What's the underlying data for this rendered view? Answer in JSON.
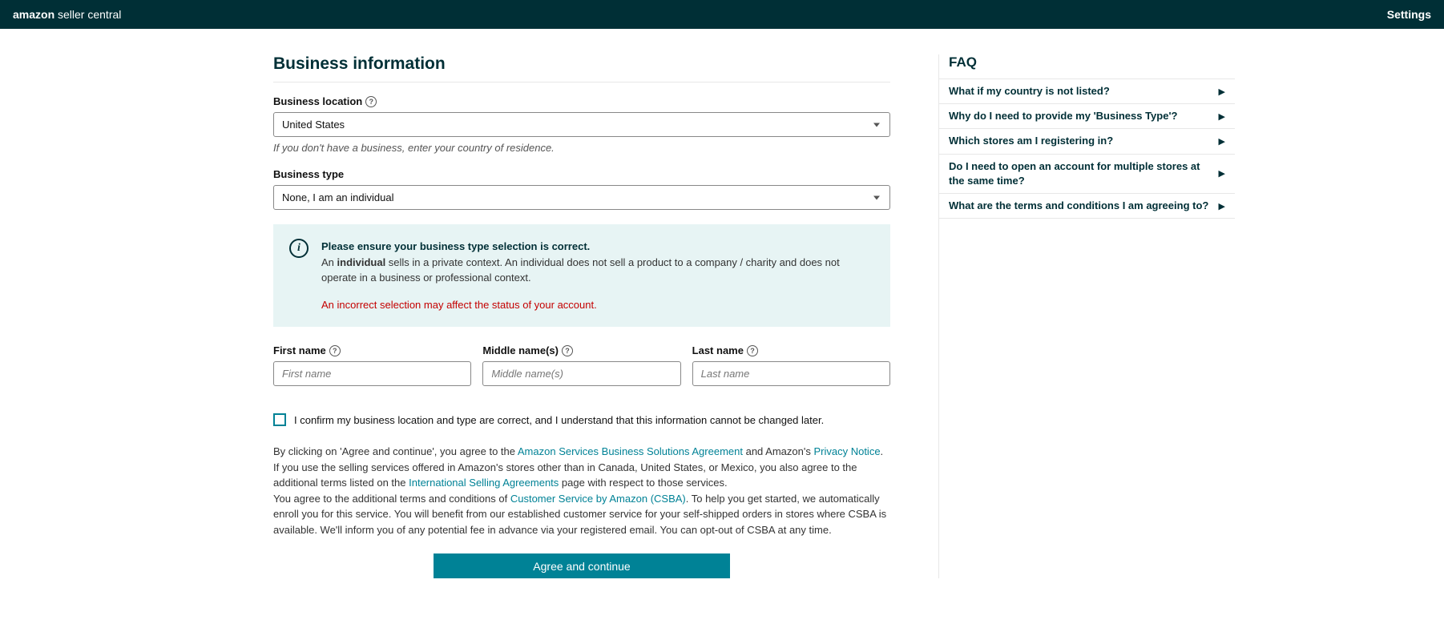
{
  "header": {
    "logo_prefix": "amazon",
    "logo_suffix": "seller central",
    "settings": "Settings"
  },
  "page": {
    "title": "Business information"
  },
  "form": {
    "business_location": {
      "label": "Business location",
      "value": "United States",
      "hint": "If you don't have a business, enter your country of residence."
    },
    "business_type": {
      "label": "Business type",
      "value": "None, I am an individual"
    },
    "first_name": {
      "label": "First name",
      "placeholder": "First name",
      "value": ""
    },
    "middle_name": {
      "label": "Middle name(s)",
      "placeholder": "Middle name(s)",
      "value": ""
    },
    "last_name": {
      "label": "Last name",
      "placeholder": "Last name",
      "value": ""
    },
    "confirm": {
      "label": "I confirm my business location and type are correct, and I understand that this information cannot be changed later."
    },
    "submit": "Agree and continue"
  },
  "alert": {
    "title": "Please ensure your business type selection is correct.",
    "line_prefix": "An ",
    "line_bold": "individual",
    "line_suffix": " sells in a private context. An individual does not sell a product to a company / charity and does not operate in a business or professional context.",
    "error": "An incorrect selection may affect the status of your account."
  },
  "legal": {
    "p1_a": "By clicking on 'Agree and continue', you agree to the ",
    "p1_link1": "Amazon Services Business Solutions Agreement",
    "p1_b": " and Amazon's ",
    "p1_link2": "Privacy Notice",
    "p1_c": ".",
    "p2_a": "If you use the selling services offered in Amazon's stores other than in Canada, United States, or Mexico, you also agree to the additional terms listed on the ",
    "p2_link": "International Selling Agreements",
    "p2_b": " page with respect to those services.",
    "p3_a": "You agree to the additional terms and conditions of ",
    "p3_link": "Customer Service by Amazon (CSBA)",
    "p3_b": ". To help you get started, we automatically enroll you for this service. You will benefit from our established customer service for your self-shipped orders in stores where CSBA is available. We'll inform you of any potential fee in advance via your registered email. You can opt-out of CSBA at any time."
  },
  "faq": {
    "title": "FAQ",
    "items": [
      "What if my country is not listed?",
      "Why do I need to provide my 'Business Type'?",
      "Which stores am I registering in?",
      "Do I need to open an account for multiple stores at the same time?",
      "What are the terms and conditions I am agreeing to?"
    ]
  }
}
